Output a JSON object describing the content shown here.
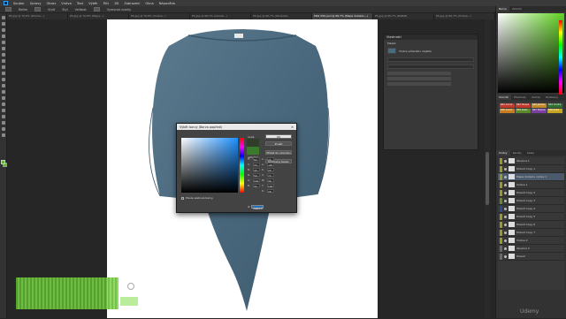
{
  "menubar": {
    "items": [
      "Soubor",
      "Úpravy",
      "Obraz",
      "Vrstva",
      "Text",
      "Výběr",
      "Filtr",
      "3D",
      "Zobrazení",
      "Okna",
      "Nápověda"
    ]
  },
  "optbar": {
    "items": [
      "Režim",
      "Krytí",
      "Styl",
      "Velikost",
      "Vyrovnat vzorky"
    ]
  },
  "tabs": [
    "PS Jpg @ 70,8% (Poloha...)",
    "PS Jpg @ 70,8% (Mapa...)",
    "PS Jpg @ 70,8% (Vrstva...)",
    "PS Jpg @ 66,7% (Vzorek...)",
    "PS Jpg @ 66,7% (Obrázek)",
    "MK1 050.psd @ 66,7% (Mapa dokladu...)",
    "PS Jpg @ 66,7% (RGB/8)",
    "PS Jpg @ 66,7% (Vrstva...)"
  ],
  "active_tab_index": 5,
  "properties_panel": {
    "title": "Vlastnosti",
    "subtitle": "Maska",
    "layer_label": "Vrstva sdíleného objektu"
  },
  "right_panels": {
    "color_tabs": [
      "Barva",
      "Vzorník"
    ],
    "swatch_tabs": [
      "Vzorník",
      "Přechody",
      "Vzorky",
      "Knihovny"
    ],
    "swatches": [
      {
        "name": "S01 černá",
        "color": "#c0392b"
      },
      {
        "name": "S02 tmavá",
        "color": "#c0392b"
      },
      {
        "name": "S03 jemná",
        "color": "#c08a2b"
      },
      {
        "name": "S04 modrá",
        "color": "#2f6f2f"
      },
      {
        "name": "S05 oranž",
        "color": "#c67c1f"
      },
      {
        "name": "S06 zelen",
        "color": "#5a8a2a"
      },
      {
        "name": "S07 fialová",
        "color": "#7a3fa0"
      },
      {
        "name": "S08 žlutá",
        "color": "#c6a51f"
      }
    ],
    "layers_tabs": [
      "Vrstvy",
      "Kanály",
      "Cesty"
    ],
    "layers": [
      {
        "name": "Skupina 1",
        "tag": "#9a9a2a"
      },
      {
        "name": "Pozadí Copy 1",
        "tag": "#9a9a2a"
      },
      {
        "name": "Mapa dokladu vrstva 1",
        "tag": "#9a9a2a",
        "selected": true
      },
      {
        "name": "Vrstva 1",
        "tag": "#9a9a2a"
      },
      {
        "name": "Pozadí Copy 2",
        "tag": "#9a9a2a"
      },
      {
        "name": "Pozadí Copy 3",
        "tag": "#6a8a2a"
      },
      {
        "name": "Pozadí Copy 4",
        "tag": "#2a4a9a"
      },
      {
        "name": "Pozadí Copy 5",
        "tag": "#9a9a2a"
      },
      {
        "name": "Pozadí Copy 6",
        "tag": "#9a9a2a"
      },
      {
        "name": "Pozadí Copy 7",
        "tag": "#9a9a2a"
      },
      {
        "name": "Vrstva 2",
        "tag": "#9a9a2a"
      },
      {
        "name": "Skupina 2",
        "tag": "#6a6a6a"
      },
      {
        "name": "Pozadí",
        "tag": "#6a6a6a"
      }
    ]
  },
  "color_dialog": {
    "title": "Výběr barvy (Barva popředí)",
    "ok_label": "OK",
    "cancel_label": "Zrušit",
    "add_swatch_label": "Přidat do vzorníku",
    "libraries_label": "Knihovny barev",
    "new_label": "nová",
    "current_label": "aktuální",
    "web_only_label": "Pouze webové barvy",
    "fields": [
      {
        "label": "H:",
        "value": "52",
        "unit": "°"
      },
      {
        "label": "L:",
        "value": "26"
      },
      {
        "label": "S:",
        "value": "70",
        "unit": "%"
      },
      {
        "label": "a:",
        "value": "-28"
      },
      {
        "label": "B:",
        "value": "40",
        "unit": "%"
      },
      {
        "label": "b:",
        "value": "25"
      },
      {
        "label": "R:",
        "value": "58"
      },
      {
        "label": "C:",
        "value": "73",
        "unit": "%"
      },
      {
        "label": "G:",
        "value": "102"
      },
      {
        "label": "M:",
        "value": "36",
        "unit": "%"
      },
      {
        "label": "B:",
        "value": "32"
      },
      {
        "label": "Y:",
        "value": "100",
        "unit": "%"
      },
      {
        "label": "",
        "value": ""
      },
      {
        "label": "K:",
        "value": "28",
        "unit": "%"
      }
    ],
    "hex_label": "#",
    "hex_value": "3a6620"
  },
  "colors": {
    "foreground": "#5cb82c",
    "accent": "#31a8ff"
  },
  "watermark": "Udemy"
}
